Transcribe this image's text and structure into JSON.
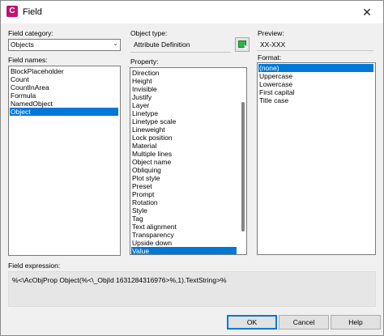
{
  "window": {
    "title": "Field",
    "icon": "autocad-icon",
    "close_glyph": "✕"
  },
  "field_category": {
    "label": "Field category:",
    "value": "Objects"
  },
  "field_names": {
    "label": "Field names:",
    "items": [
      "BlockPlaceholder",
      "Count",
      "CountInArea",
      "Formula",
      "NamedObject",
      "Object"
    ],
    "selected": "Object"
  },
  "object_type": {
    "label": "Object type:",
    "value": "Attribute Definition"
  },
  "property": {
    "label": "Property:",
    "items": [
      "Direction",
      "Height",
      "Invisible",
      "Justify",
      "Layer",
      "Linetype",
      "Linetype scale",
      "Lineweight",
      "Lock position",
      "Material",
      "Multiple lines",
      "Object name",
      "Obliquing",
      "Plot style",
      "Preset",
      "Prompt",
      "Rotation",
      "Style",
      "Tag",
      "Text alignment",
      "Transparency",
      "Upside down",
      "Value"
    ],
    "selected": "Value"
  },
  "preview": {
    "label": "Preview:",
    "value": "XX-XXX"
  },
  "format": {
    "label": "Format:",
    "items": [
      "(none)",
      "Uppercase",
      "Lowercase",
      "First capital",
      "Title case"
    ],
    "selected": "(none)"
  },
  "field_expression": {
    "label": "Field expression:",
    "value": "%<\\AcObjProp Object(%<\\_ObjId 1631284316976>%,1).TextString>%"
  },
  "buttons": {
    "ok": "OK",
    "cancel": "Cancel",
    "help": "Help"
  },
  "colors": {
    "selection": "#0078d7",
    "dialog_bg": "#f0f0f0",
    "pick_icon": "#2fb54a"
  }
}
